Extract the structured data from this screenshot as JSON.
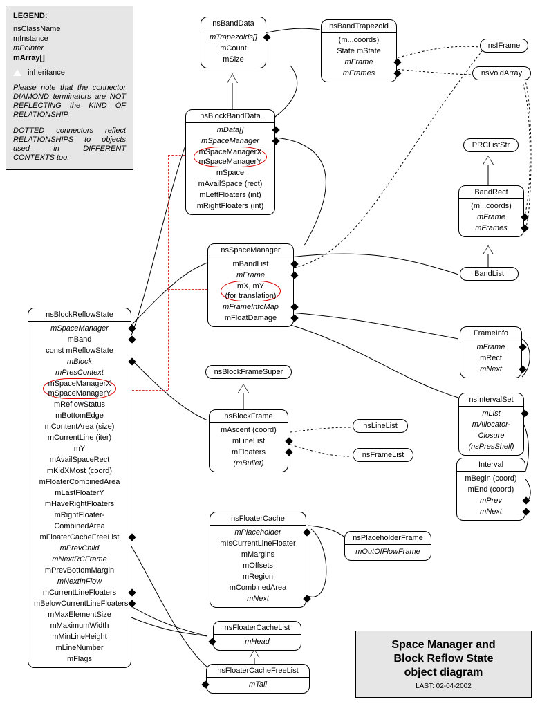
{
  "legend": {
    "title": "LEGEND:",
    "lines": [
      {
        "text": "nsClassName",
        "style": ""
      },
      {
        "text": "mInstance",
        "style": ""
      },
      {
        "text": "mPointer",
        "style": "italic"
      },
      {
        "text": "mArray[]",
        "style": "bold"
      }
    ],
    "inheritance_label": "inheritance",
    "para1": "Please note that the connector DIAMOND terminators are NOT REFLECTING the KIND OF RELATIONSHIP.",
    "para2": "DOTTED connectors reflect RELATIONSHIPS to objects used in DIFFERENT CONTEXTS too."
  },
  "title": {
    "line1": "Space Manager and",
    "line2": "Block Reflow State",
    "line3": "object diagram",
    "last": "LAST: 02-04-2002"
  },
  "classes": {
    "nsBandData": {
      "name": "nsBandData",
      "attrs": [
        {
          "t": "mTrapezoids[]",
          "i": true,
          "d": "right"
        },
        {
          "t": "mCount"
        },
        {
          "t": "mSize"
        }
      ]
    },
    "nsBandTrapezoid": {
      "name": "nsBandTrapezoid",
      "attrs": [
        {
          "t": "(m...coords)"
        },
        {
          "t": "State mState"
        },
        {
          "t": "mFrame",
          "i": true,
          "d": "right"
        },
        {
          "t": "mFrames",
          "i": true,
          "d": "right"
        }
      ]
    },
    "nsIFrame": {
      "name": "nsIFrame"
    },
    "nsVoidArray": {
      "name": "nsVoidArray"
    },
    "nsBlockBandData": {
      "name": "nsBlockBandData",
      "attrs": [
        {
          "t": "mData[]",
          "i": true,
          "d": "right"
        },
        {
          "t": "mSpaceManager",
          "i": true,
          "d": "right"
        },
        {
          "t": "mSpaceManagerX\nmSpaceManagerY",
          "circled": true
        },
        {
          "t": "mSpace"
        },
        {
          "t": "mAvailSpace (rect)"
        },
        {
          "t": "mLeftFloaters (int)"
        },
        {
          "t": "mRightFloaters (int)"
        }
      ]
    },
    "nsSpaceManager": {
      "name": "nsSpaceManager",
      "attrs": [
        {
          "t": "mBandList",
          "d": "right"
        },
        {
          "t": "mFrame",
          "i": true,
          "d": "right"
        },
        {
          "t": "mX, mY\n(for translation)",
          "circled": true
        },
        {
          "t": "mFrameInfoMap",
          "i": true,
          "d": "right"
        },
        {
          "t": "mFloatDamage",
          "d": "right"
        }
      ]
    },
    "PRCListStr": {
      "name": "PRCListStr"
    },
    "BandRect": {
      "name": "BandRect",
      "attrs": [
        {
          "t": "(m...coords)"
        },
        {
          "t": "mFrame",
          "i": true,
          "d": "right"
        },
        {
          "t": "mFrames",
          "i": true,
          "d": "right"
        }
      ]
    },
    "BandList": {
      "name": "BandList"
    },
    "FrameInfo": {
      "name": "FrameInfo",
      "attrs": [
        {
          "t": "mFrame",
          "i": true,
          "d": "right"
        },
        {
          "t": "mRect"
        },
        {
          "t": "mNext",
          "i": true,
          "d": "right"
        }
      ]
    },
    "nsIntervalSet": {
      "name": "nsIntervalSet",
      "attrs": [
        {
          "t": "mList",
          "i": true,
          "d": "right"
        },
        {
          "t": "mAllocator-\nClosure\n(nsPresShell)",
          "i": true
        }
      ]
    },
    "Interval": {
      "name": "Interval",
      "attrs": [
        {
          "t": "mBegin (coord)"
        },
        {
          "t": "mEnd (coord)"
        },
        {
          "t": "mPrev",
          "i": true,
          "d": "right"
        },
        {
          "t": "mNext",
          "i": true,
          "d": "right"
        }
      ]
    },
    "nsBlockFrameSuper": {
      "name": "nsBlockFrameSuper"
    },
    "nsBlockFrame": {
      "name": "nsBlockFrame",
      "attrs": [
        {
          "t": "mAscent (coord)"
        },
        {
          "t": "mLineList",
          "d": "right"
        },
        {
          "t": "mFloaters",
          "d": "right"
        },
        {
          "t": "(mBullet)",
          "i": true
        }
      ]
    },
    "nsLineList": {
      "name": "nsLineList"
    },
    "nsFrameList": {
      "name": "nsFrameList"
    },
    "nsFloaterCache": {
      "name": "nsFloaterCache",
      "attrs": [
        {
          "t": "mPlaceholder",
          "i": true,
          "d": "right"
        },
        {
          "t": "mIsCurrentLineFloater"
        },
        {
          "t": "mMargins"
        },
        {
          "t": "mOffsets"
        },
        {
          "t": "mRegion"
        },
        {
          "t": "mCombinedArea"
        },
        {
          "t": "mNext",
          "i": true,
          "d": "right"
        }
      ]
    },
    "nsPlaceholderFrame": {
      "name": "nsPlaceholderFrame",
      "attrs": [
        {
          "t": "mOutOfFlowFrame",
          "i": true
        }
      ]
    },
    "nsFloaterCacheList": {
      "name": "nsFloaterCacheList",
      "attrs": [
        {
          "t": "mHead",
          "i": true,
          "d": "left"
        }
      ]
    },
    "nsFloaterCacheFreeList": {
      "name": "nsFloaterCacheFreeList",
      "attrs": [
        {
          "t": "mTail",
          "i": true,
          "d": "left"
        }
      ]
    },
    "nsBlockReflowState": {
      "name": "nsBlockReflowState",
      "attrs": [
        {
          "t": "mSpaceManager",
          "i": true,
          "d": "right"
        },
        {
          "t": "mBand",
          "d": "right"
        },
        {
          "t": "const mReflowState"
        },
        {
          "t": "mBlock",
          "i": true,
          "d": "right"
        },
        {
          "t": "mPresContext",
          "i": true
        },
        {
          "t": "mSpaceManagerX\nmSpaceManagerY",
          "circled": true
        },
        {
          "t": "mReflowStatus"
        },
        {
          "t": "mBottomEdge"
        },
        {
          "t": "mContentArea (size)"
        },
        {
          "t": "mCurrentLine (iter)"
        },
        {
          "t": "mY"
        },
        {
          "t": "mAvailSpaceRect"
        },
        {
          "t": "mKidXMost (coord)"
        },
        {
          "t": "mFloaterCombinedArea"
        },
        {
          "t": "mLastFloaterY"
        },
        {
          "t": "mHaveRightFloaters"
        },
        {
          "t": "mRightFloater-\nCombinedArea"
        },
        {
          "t": "mFloaterCacheFreeList",
          "d": "right"
        },
        {
          "t": "mPrevChild",
          "i": true
        },
        {
          "t": "mNextRCFrame",
          "i": true
        },
        {
          "t": "mPrevBottomMargin"
        },
        {
          "t": "mNextInFlow",
          "i": true
        },
        {
          "t": "mCurrentLineFloaters",
          "d": "right"
        },
        {
          "t": "mBelowCurrentLineFloaters",
          "d": "right"
        },
        {
          "t": "mMaxElementSize"
        },
        {
          "t": "mMaximumWidth"
        },
        {
          "t": "mMinLineHeight"
        },
        {
          "t": "mLineNumber"
        },
        {
          "t": "mFlags"
        }
      ]
    }
  }
}
